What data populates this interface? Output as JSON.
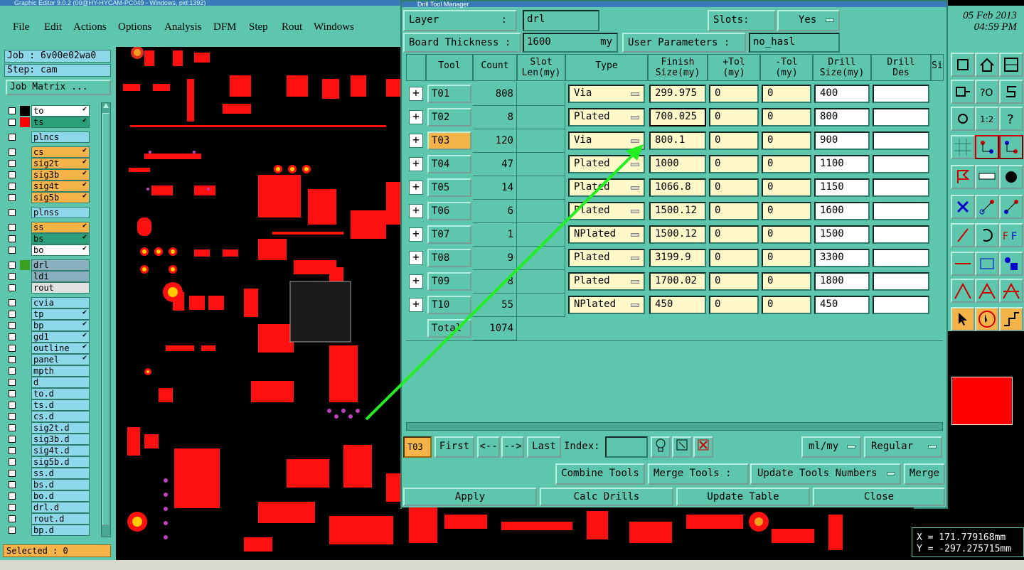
{
  "window": {
    "title": "Graphic Editor 9.0.2 (00@HY-HYCAM-PC049 - Windows, pid:1392)"
  },
  "menu": [
    {
      "label": "File"
    },
    {
      "label": "Edit"
    },
    {
      "label": "Actions"
    },
    {
      "label": "Options"
    },
    {
      "label": "Analysis"
    },
    {
      "label": "DFM"
    },
    {
      "label": "Step"
    },
    {
      "label": "Rout"
    },
    {
      "label": "Windows"
    }
  ],
  "clock": {
    "date": "05 Feb 2013",
    "time": "04:59 PM"
  },
  "job": {
    "job_label": "Job : 6v00e02wa0",
    "step_label": "Step: cam",
    "matrix_button": "Job Matrix ..."
  },
  "layers": [
    {
      "name": "to",
      "color": "#ffffff",
      "swatch": "#000000",
      "tick": true
    },
    {
      "name": "ts",
      "color": "#2aa07a",
      "swatch": "#ff0000",
      "tick": true
    },
    {
      "name": "plncs",
      "color": "#8dd8e8",
      "swatch": "",
      "tick": false
    },
    {
      "name": "cs",
      "color": "#f4b44a",
      "swatch": "",
      "tick": true
    },
    {
      "name": "sig2t",
      "color": "#f4b44a",
      "swatch": "",
      "tick": true
    },
    {
      "name": "sig3b",
      "color": "#f4b44a",
      "swatch": "",
      "tick": true
    },
    {
      "name": "sig4t",
      "color": "#f4b44a",
      "swatch": "",
      "tick": true
    },
    {
      "name": "sig5b",
      "color": "#f4b44a",
      "swatch": "",
      "tick": true
    },
    {
      "name": "plnss",
      "color": "#8dd8e8",
      "swatch": "",
      "tick": false
    },
    {
      "name": "ss",
      "color": "#f4b44a",
      "swatch": "",
      "tick": true
    },
    {
      "name": "bs",
      "color": "#2aa07a",
      "swatch": "",
      "tick": true
    },
    {
      "name": "bo",
      "color": "#ffffff",
      "swatch": "",
      "tick": true
    },
    {
      "name": "drl",
      "color": "#8ab0c0",
      "swatch": "#3aa020",
      "tick": false
    },
    {
      "name": "ldi",
      "color": "#8ab0c0",
      "swatch": "",
      "tick": false
    },
    {
      "name": "rout",
      "color": "#e0e0e0",
      "swatch": "",
      "tick": false
    },
    {
      "name": "cvia",
      "color": "#8dd8e8",
      "swatch": "",
      "tick": false
    },
    {
      "name": "tp",
      "color": "#8dd8e8",
      "swatch": "",
      "tick": true
    },
    {
      "name": "bp",
      "color": "#8dd8e8",
      "swatch": "",
      "tick": true
    },
    {
      "name": "gd1",
      "color": "#8dd8e8",
      "swatch": "",
      "tick": true
    },
    {
      "name": "outline",
      "color": "#8dd8e8",
      "swatch": "",
      "tick": true
    },
    {
      "name": "panel",
      "color": "#8dd8e8",
      "swatch": "",
      "tick": true
    },
    {
      "name": "mpth",
      "color": "#8dd8e8",
      "swatch": "",
      "tick": false
    },
    {
      "name": "d",
      "color": "#8dd8e8",
      "swatch": "",
      "tick": false
    },
    {
      "name": "to.d",
      "color": "#8dd8e8",
      "swatch": "",
      "tick": false
    },
    {
      "name": "ts.d",
      "color": "#8dd8e8",
      "swatch": "",
      "tick": false
    },
    {
      "name": "cs.d",
      "color": "#8dd8e8",
      "swatch": "",
      "tick": false
    },
    {
      "name": "sig2t.d",
      "color": "#8dd8e8",
      "swatch": "",
      "tick": false
    },
    {
      "name": "sig3b.d",
      "color": "#8dd8e8",
      "swatch": "",
      "tick": false
    },
    {
      "name": "sig4t.d",
      "color": "#8dd8e8",
      "swatch": "",
      "tick": false
    },
    {
      "name": "sig5b.d",
      "color": "#8dd8e8",
      "swatch": "",
      "tick": false
    },
    {
      "name": "ss.d",
      "color": "#8dd8e8",
      "swatch": "",
      "tick": false
    },
    {
      "name": "bs.d",
      "color": "#8dd8e8",
      "swatch": "",
      "tick": false
    },
    {
      "name": "bo.d",
      "color": "#8dd8e8",
      "swatch": "",
      "tick": false
    },
    {
      "name": "drl.d",
      "color": "#8dd8e8",
      "swatch": "",
      "tick": false
    },
    {
      "name": "rout.d",
      "color": "#8dd8e8",
      "swatch": "",
      "tick": false
    },
    {
      "name": "bp.d",
      "color": "#8dd8e8",
      "swatch": "",
      "tick": false
    }
  ],
  "selected": "Selected : 0",
  "dialog": {
    "title": "Drill Tool Manager",
    "layer_label": "Layer",
    "layer_colon": ":",
    "layer_value": "drl",
    "slots_label": "Slots:",
    "slots_value": "Yes",
    "thickness_label": "Board Thickness :",
    "thickness_value": "1600",
    "thickness_unit": "my",
    "user_params_label": "User Parameters :",
    "user_params_value": "no_hasl",
    "columns": [
      "Tool",
      "Count",
      "Slot\nLen(my)",
      "Type",
      "Finish\nSize(my)",
      "+Tol\n(my)",
      "-Tol\n(my)",
      "Drill\nSize(my)",
      "Drill\nDes",
      "Si"
    ],
    "rows": [
      {
        "tool": "T01",
        "count": "808",
        "slot_len": "",
        "type": "Via",
        "finish": "299.975",
        "ptol": "0",
        "mtol": "0",
        "drill": "400",
        "des": ""
      },
      {
        "tool": "T02",
        "count": "8",
        "slot_len": "",
        "type": "Plated",
        "finish": "700.025",
        "ptol": "0",
        "mtol": "0",
        "drill": "800",
        "des": ""
      },
      {
        "tool": "T03",
        "count": "120",
        "slot_len": "",
        "type": "Via",
        "finish": "800.1",
        "ptol": "0",
        "mtol": "0",
        "drill": "900",
        "des": "",
        "selected": true
      },
      {
        "tool": "T04",
        "count": "47",
        "slot_len": "",
        "type": "Plated",
        "finish": "1000",
        "ptol": "0",
        "mtol": "0",
        "drill": "1100",
        "des": ""
      },
      {
        "tool": "T05",
        "count": "14",
        "slot_len": "",
        "type": "Plated",
        "finish": "1066.8",
        "ptol": "0",
        "mtol": "0",
        "drill": "1150",
        "des": ""
      },
      {
        "tool": "T06",
        "count": "6",
        "slot_len": "",
        "type": "Plated",
        "finish": "1500.12",
        "ptol": "0",
        "mtol": "0",
        "drill": "1600",
        "des": ""
      },
      {
        "tool": "T07",
        "count": "1",
        "slot_len": "",
        "type": "NPlated",
        "finish": "1500.12",
        "ptol": "0",
        "mtol": "0",
        "drill": "1500",
        "des": ""
      },
      {
        "tool": "T08",
        "count": "9",
        "slot_len": "",
        "type": "Plated",
        "finish": "3199.9",
        "ptol": "0",
        "mtol": "0",
        "drill": "3300",
        "des": ""
      },
      {
        "tool": "T09",
        "count": "8",
        "slot_len": "",
        "type": "Plated",
        "finish": "1700.02",
        "ptol": "0",
        "mtol": "0",
        "drill": "1800",
        "des": ""
      },
      {
        "tool": "T10",
        "count": "55",
        "slot_len": "",
        "type": "NPlated",
        "finish": "450",
        "ptol": "0",
        "mtol": "0",
        "drill": "450",
        "des": ""
      }
    ],
    "total_label": "Total",
    "total_count": "1074",
    "nav": {
      "current": "T03",
      "first": "First",
      "prev": "<--",
      "next": "-->",
      "last": "Last",
      "index_label": "Index:",
      "units": "ml/my",
      "mode": "Regular"
    },
    "actions": {
      "combine": "Combine Tools",
      "merge_label": "Merge Tools :",
      "update_numbers": "Update Tools Numbers",
      "merge": "Merge"
    },
    "footer": {
      "apply": "Apply",
      "calc": "Calc Drills",
      "update": "Update Table",
      "close": "Close"
    }
  },
  "coords": {
    "x": "X = 171.779168mm",
    "y": "Y = -297.275715mm"
  },
  "colors": {
    "panel": "#5ec6ad",
    "highlight": "#f4b44a",
    "copper": "#ff0000",
    "arrow": "#22ee22"
  }
}
